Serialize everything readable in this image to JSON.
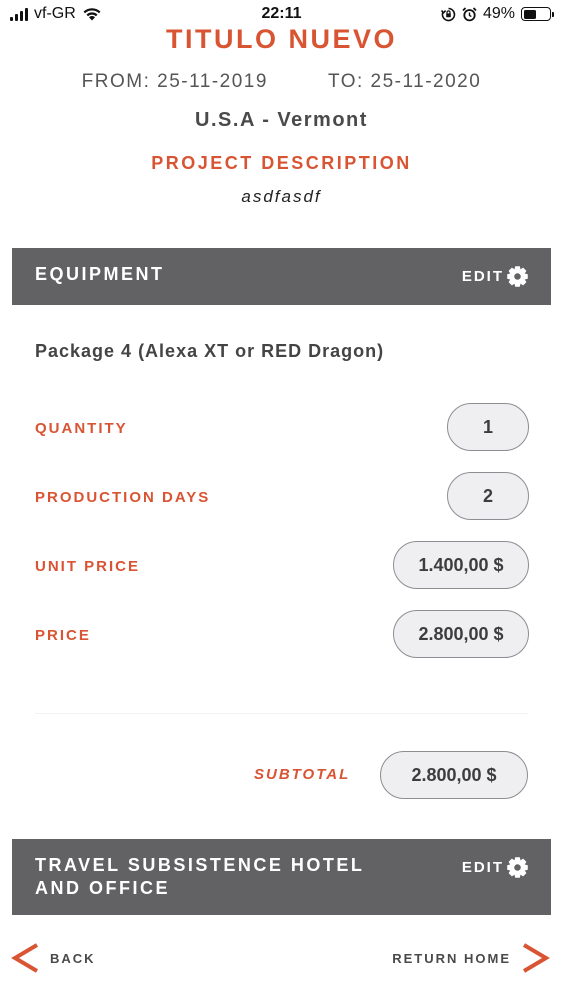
{
  "status_bar": {
    "carrier": "vf-GR",
    "time": "22:11",
    "battery": "49%",
    "battery_level": 0.49
  },
  "header": {
    "title": "TITULO NUEVO",
    "from": "FROM: 25-11-2019",
    "to": "TO: 25-11-2020",
    "location": "U.S.A - Vermont",
    "project_description_label": "PROJECT DESCRIPTION",
    "project_description": "asdfasdf"
  },
  "equipment": {
    "title": "EQUIPMENT",
    "edit_label": "EDIT",
    "package": "Package 4 (Alexa XT or RED Dragon)",
    "rows": [
      {
        "label": "QUANTITY",
        "value": "1"
      },
      {
        "label": "PRODUCTION DAYS",
        "value": "2"
      },
      {
        "label": "UNIT PRICE",
        "value": "1.400,00 $"
      },
      {
        "label": "PRICE",
        "value": "2.800,00 $"
      }
    ],
    "subtotal_label": "SUBTOTAL",
    "subtotal_value": "2.800,00 $"
  },
  "travel": {
    "title_line1": "TRAVEL SUBSISTENCE HOTEL",
    "title_line2": "AND OFFICE",
    "edit_label": "EDIT"
  },
  "nav": {
    "back": "BACK",
    "return_home": "RETURN HOME"
  },
  "colors": {
    "accent": "#d95432",
    "header_bg": "#626164",
    "text": "#3d3d3f",
    "pill_bg": "#efeff2"
  }
}
